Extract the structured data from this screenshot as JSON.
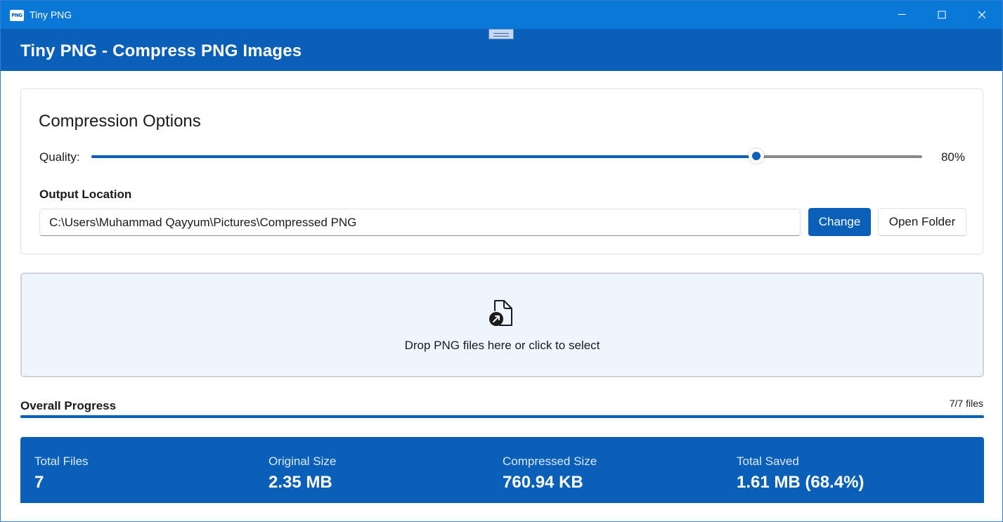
{
  "window": {
    "title": "Tiny PNG",
    "icon": "png-app-icon",
    "icon_text": "PNG"
  },
  "header": {
    "title": "Tiny PNG - Compress PNG Images"
  },
  "options": {
    "title": "Compression Options",
    "quality_label": "Quality:",
    "quality_value": "80%",
    "quality_fraction": 0.8,
    "output_label": "Output Location",
    "output_path": "C:\\Users\\Muhammad Qayyum\\Pictures\\Compressed PNG",
    "change_label": "Change",
    "open_folder_label": "Open Folder"
  },
  "dropzone": {
    "text": "Drop PNG files here or click to select",
    "icon": "document-arrow-icon"
  },
  "progress": {
    "label": "Overall Progress",
    "count": "7/7 files",
    "fraction": 1.0
  },
  "stats": [
    {
      "label": "Total Files",
      "value": "7"
    },
    {
      "label": "Original Size",
      "value": "2.35 MB"
    },
    {
      "label": "Compressed Size",
      "value": "760.94 KB"
    },
    {
      "label": "Total Saved",
      "value": "1.61 MB (68.4%)"
    }
  ],
  "colors": {
    "titlebar": "#0a78d7",
    "accent": "#0a60b8",
    "dropzone_bg": "#eef5fd"
  }
}
